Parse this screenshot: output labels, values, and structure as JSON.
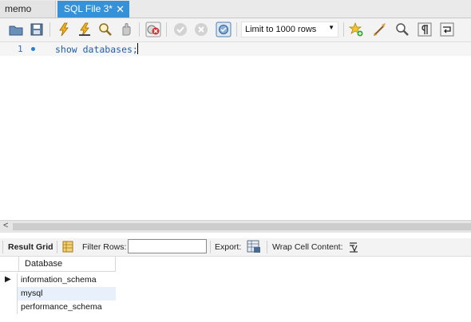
{
  "tabs": [
    {
      "label": "memo"
    },
    {
      "label": "SQL File 3*",
      "close": "✕"
    }
  ],
  "toolbar": {
    "limit_select": {
      "value": "Limit to 1000 rows"
    }
  },
  "editor": {
    "line_number": "1",
    "code": "show databases;"
  },
  "scrollbar": {
    "left_arrow": "<"
  },
  "result": {
    "result_grid_label": "Result Grid",
    "filter_label": "Filter Rows:",
    "filter_value": "",
    "export_label": "Export:",
    "wrap_label": "Wrap Cell Content:",
    "columns": [
      "Database"
    ],
    "rows": [
      "information_schema",
      "mysql",
      "performance_schema"
    ]
  },
  "colors": {
    "active_tab": "#3592d8",
    "selected_row": "#e8f1fb",
    "code_text": "#1f5fa8"
  }
}
